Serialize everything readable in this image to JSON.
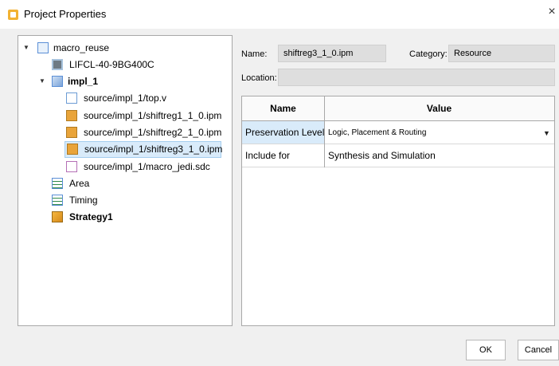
{
  "window": {
    "title": "Project Properties",
    "close_glyph": "×"
  },
  "tree": {
    "root": {
      "label": "macro_reuse",
      "icon": "project-icon"
    },
    "device": {
      "label": "LIFCL-40-9BG400C",
      "icon": "chip-icon"
    },
    "impl": {
      "label": "impl_1",
      "icon": "implementation-icon"
    },
    "files": [
      {
        "label": "source/impl_1/top.v",
        "icon": "verilog-file-icon"
      },
      {
        "label": "source/impl_1/shiftreg1_1_0.ipm",
        "icon": "ipm-file-icon"
      },
      {
        "label": "source/impl_1/shiftreg2_1_0.ipm",
        "icon": "ipm-file-icon"
      },
      {
        "label": "source/impl_1/shiftreg3_1_0.ipm",
        "icon": "ipm-file-icon",
        "selected": true
      },
      {
        "label": "source/impl_1/macro_jedi.sdc",
        "icon": "sdc-file-icon"
      }
    ],
    "area": {
      "label": "Area",
      "icon": "area-icon"
    },
    "timing": {
      "label": "Timing",
      "icon": "timing-icon"
    },
    "strategy": {
      "label": "Strategy1",
      "icon": "strategy-icon"
    }
  },
  "props": {
    "name_label": "Name:",
    "name_value": "shiftreg3_1_0.ipm",
    "category_label": "Category:",
    "category_value": "Resource",
    "location_label": "Location:",
    "location_value": ""
  },
  "grid": {
    "col_name": "Name",
    "col_value": "Value",
    "rows": [
      {
        "name": "Preservation Level",
        "value": "Logic, Placement & Routing",
        "dropdown": true
      },
      {
        "name": "Include for",
        "value": "Synthesis and Simulation"
      }
    ]
  },
  "buttons": {
    "ok": "OK",
    "cancel": "Cancel"
  },
  "colors": {
    "selection": "#d9ebfa",
    "selection_border": "#a5cdee",
    "accent": "#f2b233"
  }
}
